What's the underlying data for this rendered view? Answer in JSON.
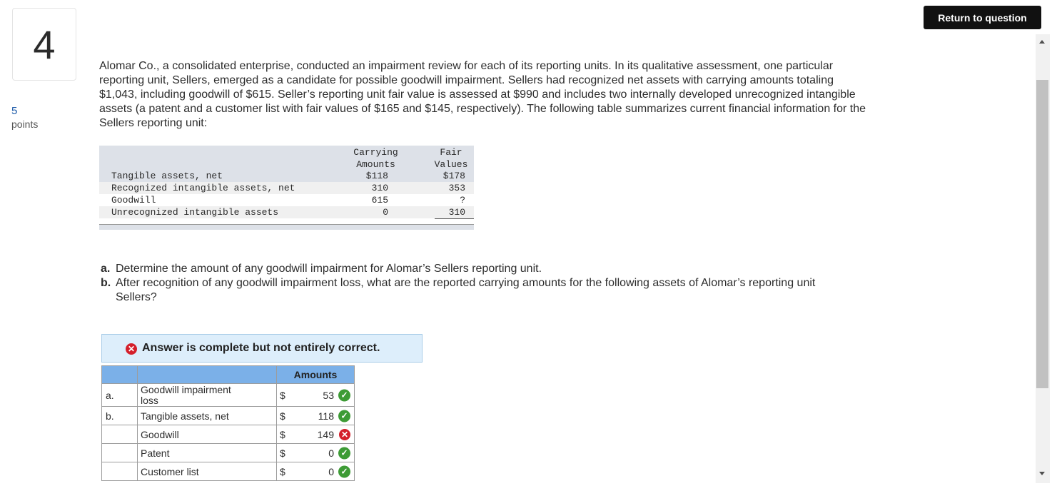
{
  "question": {
    "number": "4",
    "points_value": "5",
    "points_label": "points"
  },
  "header": {
    "return_button": "Return to question"
  },
  "scrollbar": {
    "up_icon": "scroll-up-arrow",
    "down_icon": "scroll-down-arrow"
  },
  "problem_text": "Alomar Co., a consolidated enterprise, conducted an impairment review for each of its reporting units. In its qualitative assessment, one particular reporting unit, Sellers, emerged as a candidate for possible goodwill impairment. Sellers had recognized net assets with carrying amounts totaling $1,043, including goodwill of $615. Seller’s reporting unit fair value is assessed at $990 and includes two internally developed unrecognized intangible assets (a patent and a customer list with fair values of $165 and $145, respectively). The following table summarizes current financial information for the Sellers reporting unit:",
  "financial_table": {
    "headers": {
      "carrying_line1": "Carrying",
      "carrying_line2": "Amounts",
      "fair_line1": "Fair",
      "fair_line2": "Values"
    },
    "rows": [
      {
        "label": "Tangible assets, net",
        "carrying": "$118",
        "fair": "$178"
      },
      {
        "label": "Recognized intangible assets, net",
        "carrying": "310",
        "fair": "353"
      },
      {
        "label": "Goodwill",
        "carrying": "615",
        "fair": "?"
      },
      {
        "label": "Unrecognized intangible assets",
        "carrying": "0",
        "fair": "310"
      }
    ]
  },
  "questions": [
    {
      "letter": "a.",
      "text": "Determine the amount of any goodwill impairment for Alomar’s Sellers reporting unit."
    },
    {
      "letter": "b.",
      "text": "After recognition of any goodwill impairment loss, what are the reported carrying amounts for the following assets of Alomar’s reporting unit Sellers?"
    }
  ],
  "answer_banner": {
    "text": "Answer is complete but not entirely correct.",
    "icon": "x-icon"
  },
  "answer_table": {
    "header": "Amounts",
    "rows": [
      {
        "part": "a.",
        "label": "Goodwill impairment loss",
        "currency": "$",
        "value": "53",
        "status": "correct"
      },
      {
        "part": "b.",
        "label": "Tangible assets, net",
        "currency": "$",
        "value": "118",
        "status": "correct"
      },
      {
        "part": "",
        "label": "Goodwill",
        "currency": "$",
        "value": "149",
        "status": "incorrect"
      },
      {
        "part": "",
        "label": "Patent",
        "currency": "$",
        "value": "0",
        "status": "correct"
      },
      {
        "part": "",
        "label": "Customer list",
        "currency": "$",
        "value": "0",
        "status": "correct"
      }
    ]
  },
  "colors": {
    "correct": "#3d9b35",
    "incorrect": "#d41f2b",
    "table_header": "#7bb0e8",
    "banner_bg": "#ddeefb"
  }
}
